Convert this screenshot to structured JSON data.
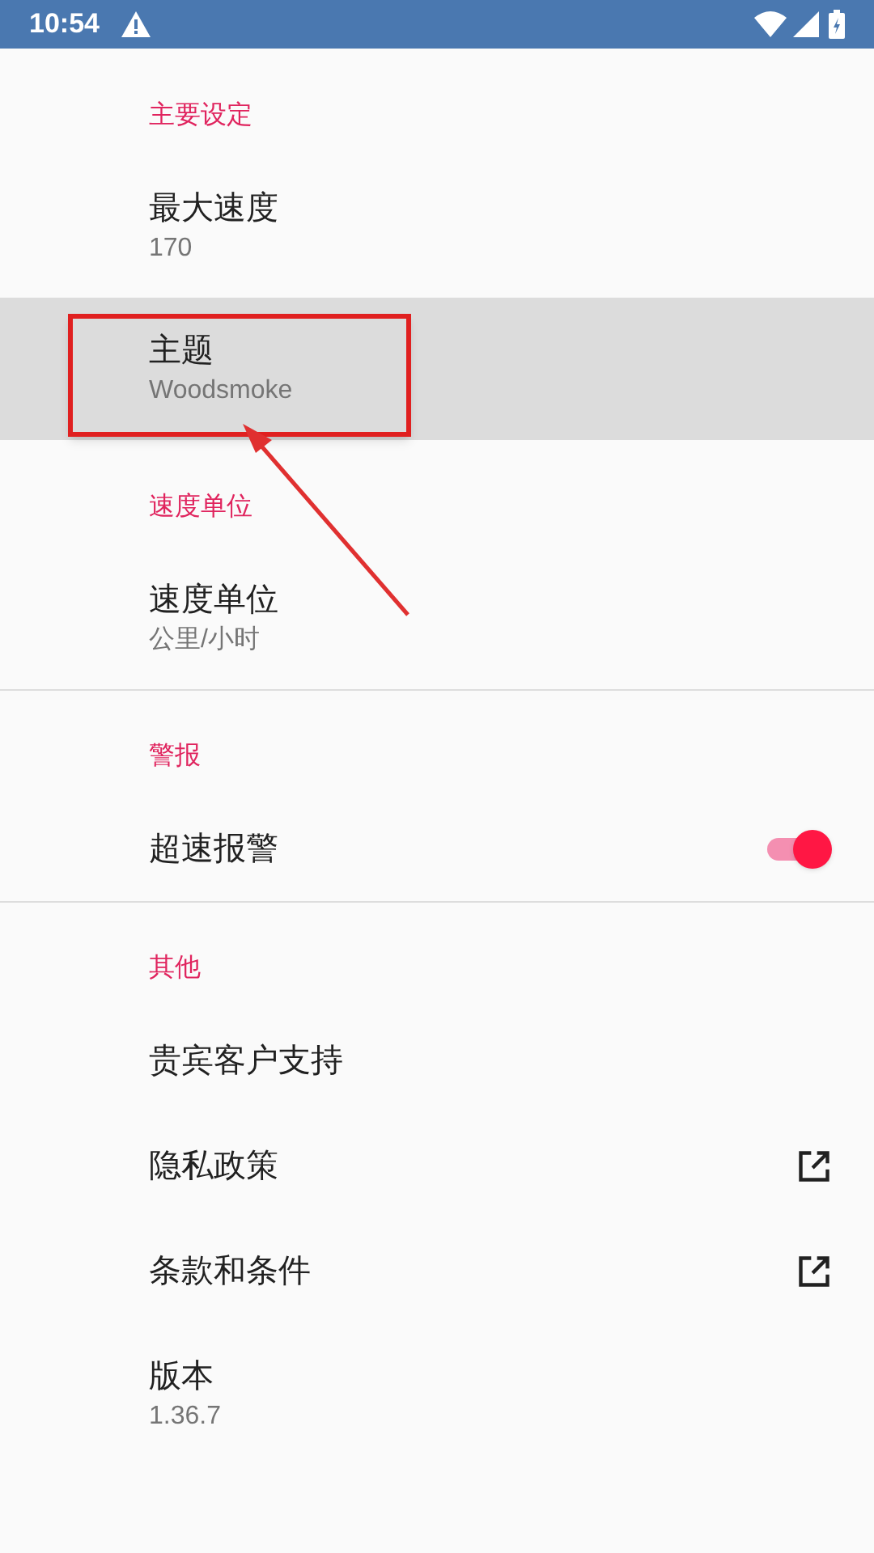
{
  "status_bar": {
    "time": "10:54"
  },
  "sections": [
    {
      "title": "主要设定",
      "divider": false,
      "items": [
        {
          "kind": "subtitle",
          "title": "最大速度",
          "subtitle": "170",
          "selected": false
        },
        {
          "kind": "subtitle",
          "title": "主题",
          "subtitle": "Woodsmoke",
          "selected": true
        }
      ]
    },
    {
      "title": "速度单位",
      "divider": false,
      "items": [
        {
          "kind": "subtitle",
          "title": "速度单位",
          "subtitle": "公里/小时",
          "selected": false
        }
      ]
    },
    {
      "title": "警报",
      "divider": true,
      "items": [
        {
          "kind": "toggle",
          "title": "超速报警",
          "on": true,
          "selected": false
        }
      ]
    },
    {
      "title": "其他",
      "divider": true,
      "items": [
        {
          "kind": "plain",
          "title": "贵宾客户支持",
          "selected": false
        },
        {
          "kind": "link",
          "title": "隐私政策",
          "selected": false
        },
        {
          "kind": "link",
          "title": "条款和条件",
          "selected": false
        },
        {
          "kind": "subtitle",
          "title": "版本",
          "subtitle": "1.36.7",
          "selected": false
        }
      ]
    }
  ]
}
